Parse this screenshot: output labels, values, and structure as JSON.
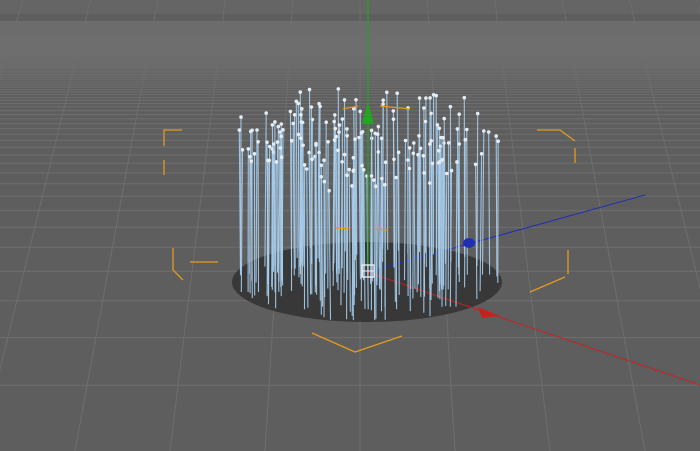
{
  "viewport": {
    "background_color": "#5e5e5e",
    "grid_color": "#6e6e6e",
    "selection_bracket_color": "#e39a1e",
    "object_shadow_color": "#383838",
    "particle_line_color": "#a9cfee",
    "particle_dot_color": "#e4ecf4",
    "axis_colors": {
      "x": "#c8201f",
      "y": "#22a51f",
      "z": "#1f2fb4"
    },
    "icons": [
      "emitter-icon",
      "x-axis-handle-icon",
      "y-axis-handle-icon",
      "z-axis-handle-icon"
    ]
  }
}
